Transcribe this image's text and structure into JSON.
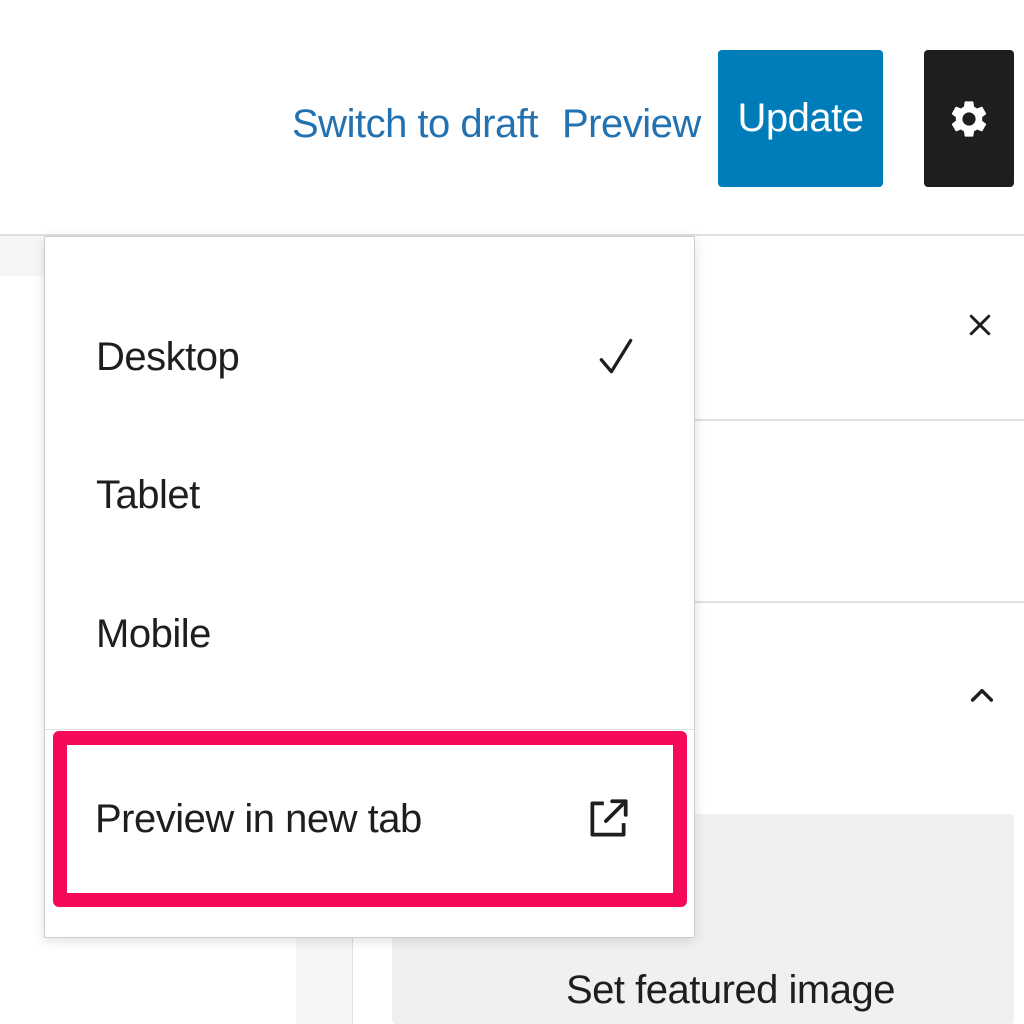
{
  "toolbar": {
    "switch_to_draft_label": "Switch to draft",
    "preview_label": "Preview",
    "update_label": "Update",
    "settings_icon": "gear-icon"
  },
  "preview_menu": {
    "items": [
      {
        "label": "Desktop",
        "selected": true
      },
      {
        "label": "Tablet",
        "selected": false
      },
      {
        "label": "Mobile",
        "selected": false
      }
    ],
    "new_tab_label": "Preview in new tab",
    "new_tab_icon": "external-link-icon",
    "highlight_color": "#f5095a"
  },
  "sidebar": {
    "close_icon": "close-icon",
    "collapse_icon": "chevron-up-icon",
    "featured_image_label": "Set featured image"
  },
  "colors": {
    "accent": "#007cba",
    "link": "#2271b1",
    "settings_bg": "#1e1e1e"
  }
}
